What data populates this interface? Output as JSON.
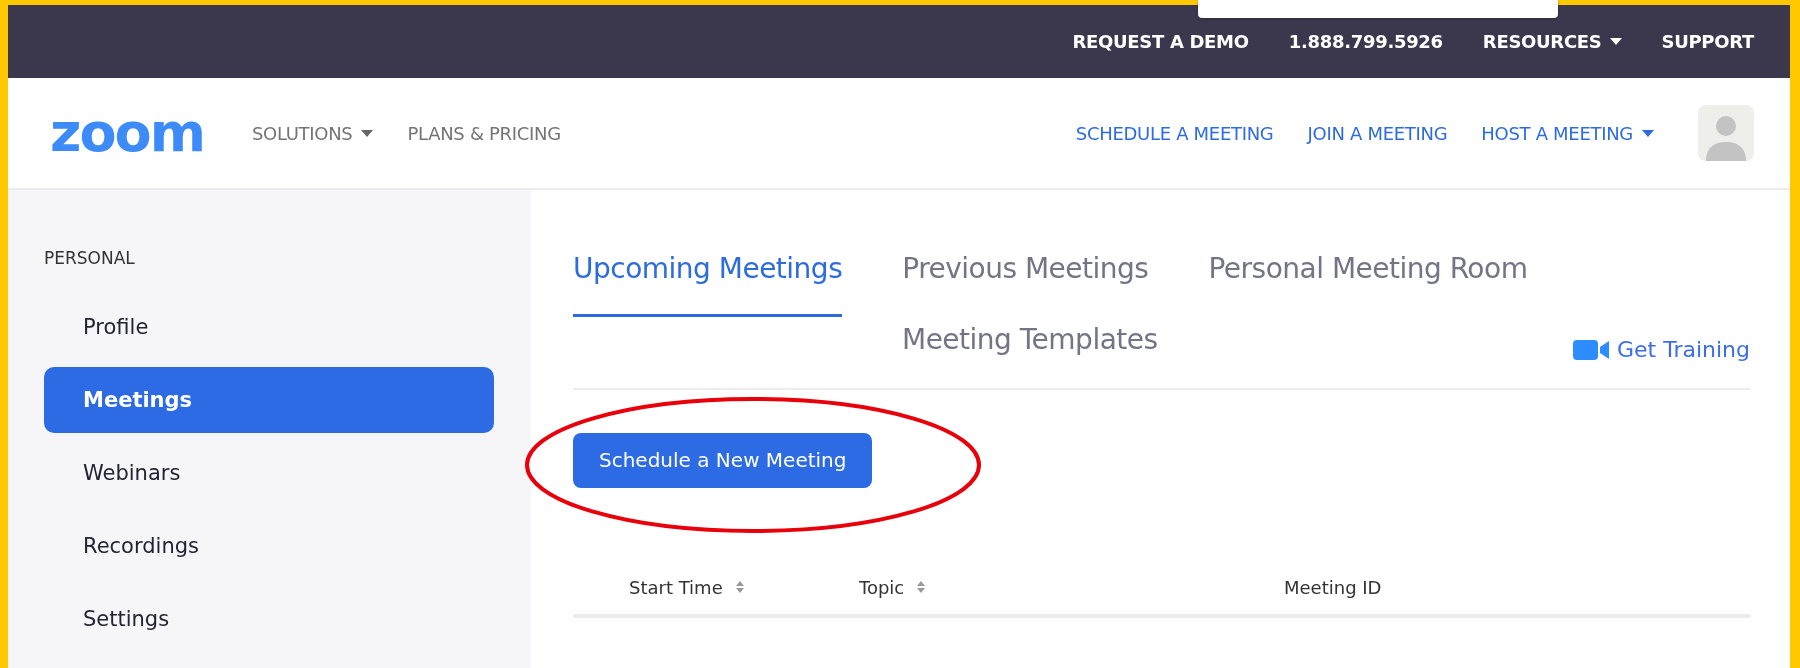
{
  "top_bar": {
    "links": [
      {
        "label": "REQUEST A DEMO",
        "dropdown": false
      },
      {
        "label": "1.888.799.5926",
        "dropdown": false
      },
      {
        "label": "RESOURCES",
        "dropdown": true
      },
      {
        "label": "SUPPORT",
        "dropdown": false
      }
    ]
  },
  "nav": {
    "logo": "zoom",
    "left_links": [
      {
        "label": "SOLUTIONS",
        "dropdown": true
      },
      {
        "label": "PLANS & PRICING",
        "dropdown": false
      }
    ],
    "right_links": [
      {
        "label": "SCHEDULE A MEETING",
        "dropdown": false
      },
      {
        "label": "JOIN A MEETING",
        "dropdown": false
      },
      {
        "label": "HOST A MEETING",
        "dropdown": true
      }
    ]
  },
  "sidebar": {
    "heading": "PERSONAL",
    "items": [
      {
        "label": "Profile",
        "selected": false
      },
      {
        "label": "Meetings",
        "selected": true
      },
      {
        "label": "Webinars",
        "selected": false
      },
      {
        "label": "Recordings",
        "selected": false
      },
      {
        "label": "Settings",
        "selected": false
      }
    ]
  },
  "tabs": [
    {
      "label": "Upcoming Meetings",
      "selected": true
    },
    {
      "label": "Previous Meetings",
      "selected": false
    },
    {
      "label": "Personal Meeting Room",
      "selected": false
    },
    {
      "label": "Meeting Templates",
      "selected": false
    }
  ],
  "get_training": "Get Training",
  "schedule_button": "Schedule a New Meeting",
  "table": {
    "columns": [
      {
        "label": "Start Time",
        "sortable": true
      },
      {
        "label": "Topic",
        "sortable": true
      },
      {
        "label": "Meeting ID",
        "sortable": false
      }
    ]
  }
}
